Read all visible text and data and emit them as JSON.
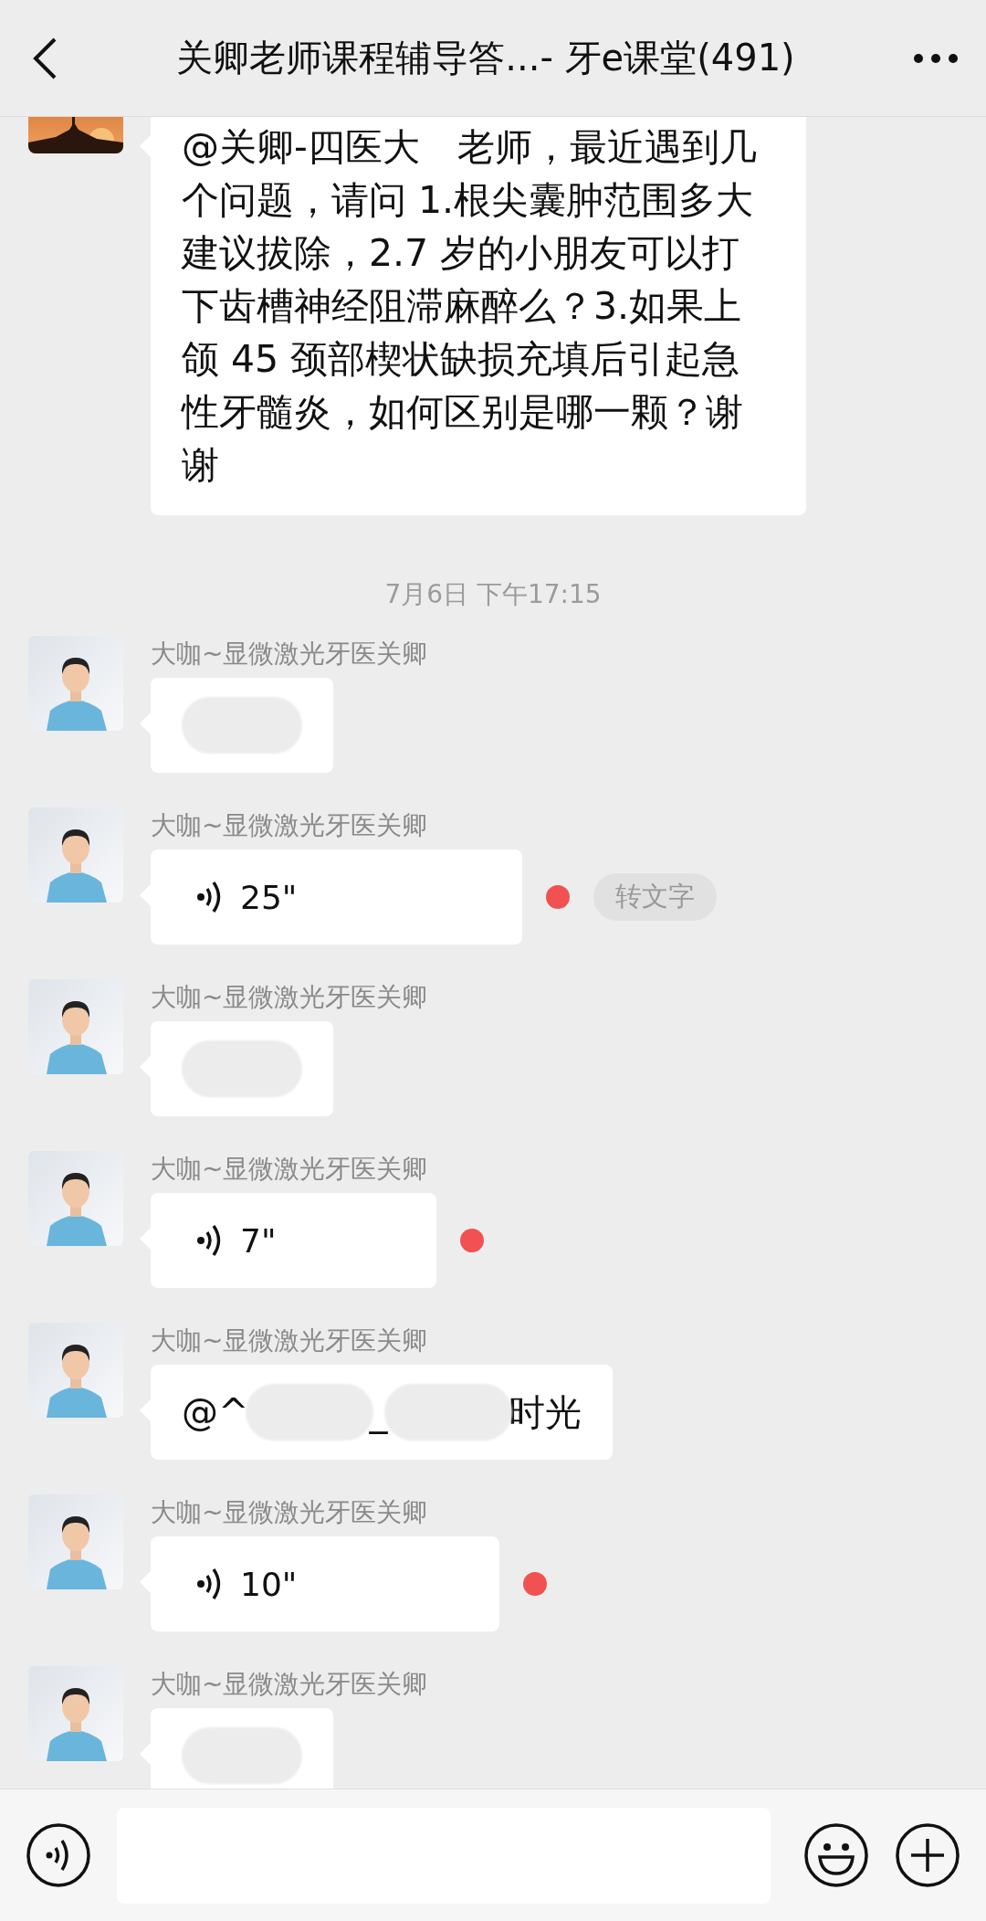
{
  "header": {
    "title": "关卿老师课程辅导答...- 牙e课堂(491)"
  },
  "messages": [
    {
      "kind": "text",
      "text": "@关卿-四医大　老师，最近遇到几个问题，请问 1.根尖囊肿范围多大建议拔除，2.7 岁的小朋友可以打下齿槽神经阻滞麻醉么？3.如果上颌 45 颈部楔状缺损充填后引起急性牙髓炎，如何区别是哪一颗？谢谢"
    },
    {
      "kind": "timestamp",
      "text": "7月6日 下午17:15"
    },
    {
      "kind": "redacted",
      "sender": "大咖~显微激光牙医关卿"
    },
    {
      "kind": "voice",
      "sender": "大咖~显微激光牙医关卿",
      "duration": "25\"",
      "unread": true,
      "transcribe_label": "转文字"
    },
    {
      "kind": "redacted",
      "sender": "大咖~显微激光牙医关卿"
    },
    {
      "kind": "voice",
      "sender": "大咖~显微激光牙医关卿",
      "duration": "7\"",
      "unread": true
    },
    {
      "kind": "mention",
      "sender": "大咖~显微激光牙医关卿",
      "parts": [
        {
          "kind": "text",
          "text": "@^"
        },
        {
          "kind": "blot"
        },
        {
          "kind": "text",
          "text": "_"
        },
        {
          "kind": "blot"
        },
        {
          "kind": "text",
          "text": "时光"
        }
      ]
    },
    {
      "kind": "voice",
      "sender": "大咖~显微激光牙医关卿",
      "duration": "10\"",
      "unread": true
    },
    {
      "kind": "redacted",
      "sender": "大咖~显微激光牙医关卿"
    }
  ]
}
